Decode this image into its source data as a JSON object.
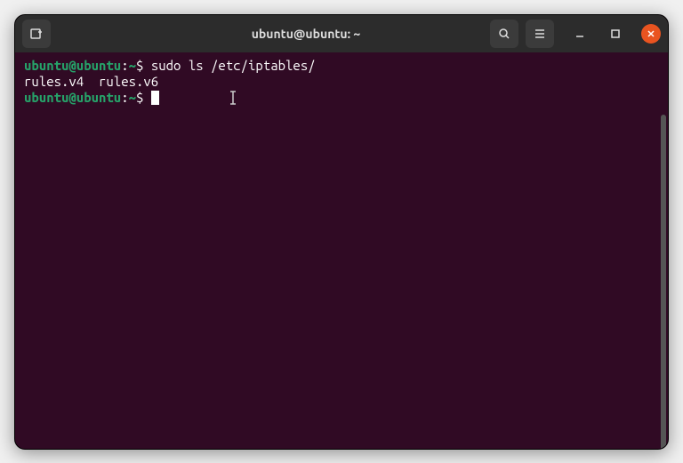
{
  "window": {
    "title": "ubuntu@ubuntu: ~"
  },
  "terminal": {
    "line1": {
      "user_host": "ubuntu@ubuntu",
      "colon": ":",
      "path": "~",
      "dollar": "$ ",
      "command": "sudo ls /etc/iptables/"
    },
    "output": "rules.v4  rules.v6",
    "line2": {
      "user_host": "ubuntu@ubuntu",
      "colon": ":",
      "path": "~",
      "dollar": "$ "
    }
  }
}
